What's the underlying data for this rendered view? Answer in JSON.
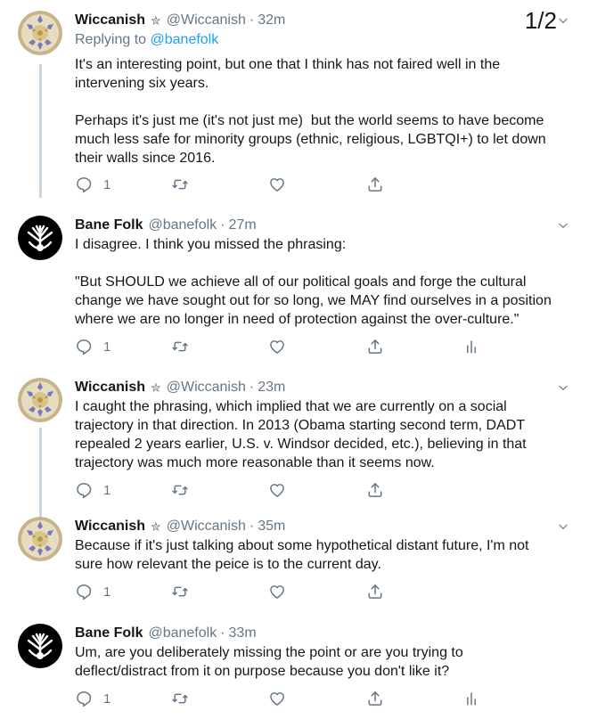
{
  "thread_counter": "1/2",
  "tweets": [
    {
      "name": "Wiccanish",
      "star": "✮",
      "handle": "@Wiccanish",
      "dot": "·",
      "time": "32m",
      "replying_prefix": "Replying to",
      "replying_to": "@banefolk",
      "text": "It's an interesting point, but one that I think has not faired well in the\nintervening six years.\n\nPerhaps it's just me (it's not just me)  but the world seems to have become\nmuch less safe for minority groups (ethnic, religious, LGBTQI+) to let down\ntheir walls since 2016.",
      "reply_count": "1",
      "avatar_icon": "flower-plate-avatar"
    },
    {
      "name": "Bane Folk",
      "handle": "@banefolk",
      "dot": "·",
      "time": "27m",
      "text": "I disagree. I think you missed the phrasing:\n\n\"But SHOULD we achieve all of our political goals and forge the cultural\nchange we have sought out for so long, we MAY find ourselves in a position\nwhere we are no longer in need of protection against the over-culture.\"",
      "reply_count": "1",
      "avatar_icon": "tree-roots-avatar"
    },
    {
      "name": "Wiccanish",
      "star": "✮",
      "handle": "@Wiccanish",
      "dot": "·",
      "time": "23m",
      "text": "I caught the phrasing, which implied that we are currently on a social\ntrajectory in that direction. In 2013 (Obama starting second term, DADT\nrepealed 2 years earlier, U.S. v. Windsor decided, etc.), believing in that\ntrajectory was much more reasonable than it seems now.",
      "reply_count": "1",
      "avatar_icon": "flower-plate-avatar"
    },
    {
      "name": "Wiccanish",
      "star": "✮",
      "handle": "@Wiccanish",
      "dot": "·",
      "time": "35m",
      "text": "Because if it's just talking about some hypothetical distant future, I'm not\nsure how relevant the peice is to the current day.",
      "reply_count": "1",
      "avatar_icon": "flower-plate-avatar"
    },
    {
      "name": "Bane Folk",
      "handle": "@banefolk",
      "dot": "·",
      "time": "33m",
      "text": "Um, are you deliberately missing the point or are you trying to\ndeflect/distract from it on purpose because you don't like it?",
      "reply_count": "1",
      "avatar_icon": "tree-roots-avatar"
    }
  ],
  "colors": {
    "text": "#14171a",
    "secondary": "#657786",
    "link": "#1da1f2",
    "thread_line": "#ccd6dd"
  }
}
